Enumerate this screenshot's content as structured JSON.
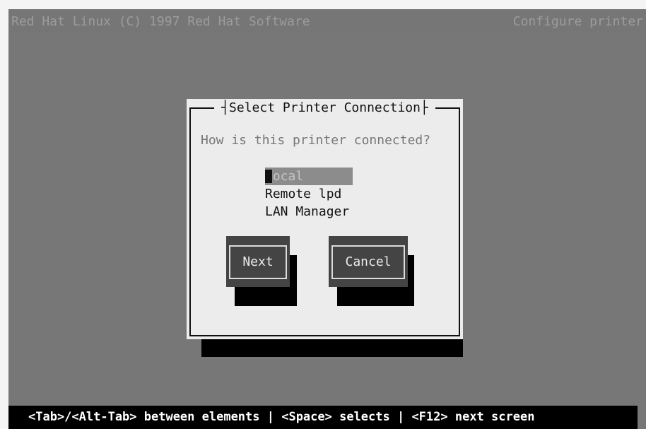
{
  "topbar": {
    "left_text": "Red Hat Linux (C) 1997 Red Hat Software",
    "right_text": "Configure printer"
  },
  "dialog": {
    "title": "Select Printer Connection",
    "question": "How is this printer connected?",
    "options": [
      "Local",
      "Remote lpd",
      "LAN Manager"
    ],
    "selected_option": "Local",
    "next_label": "Next",
    "cancel_label": "Cancel"
  },
  "statusbar": {
    "text": "<Tab>/<Alt-Tab> between elements   |  <Space> selects   |  <F12> next screen"
  }
}
